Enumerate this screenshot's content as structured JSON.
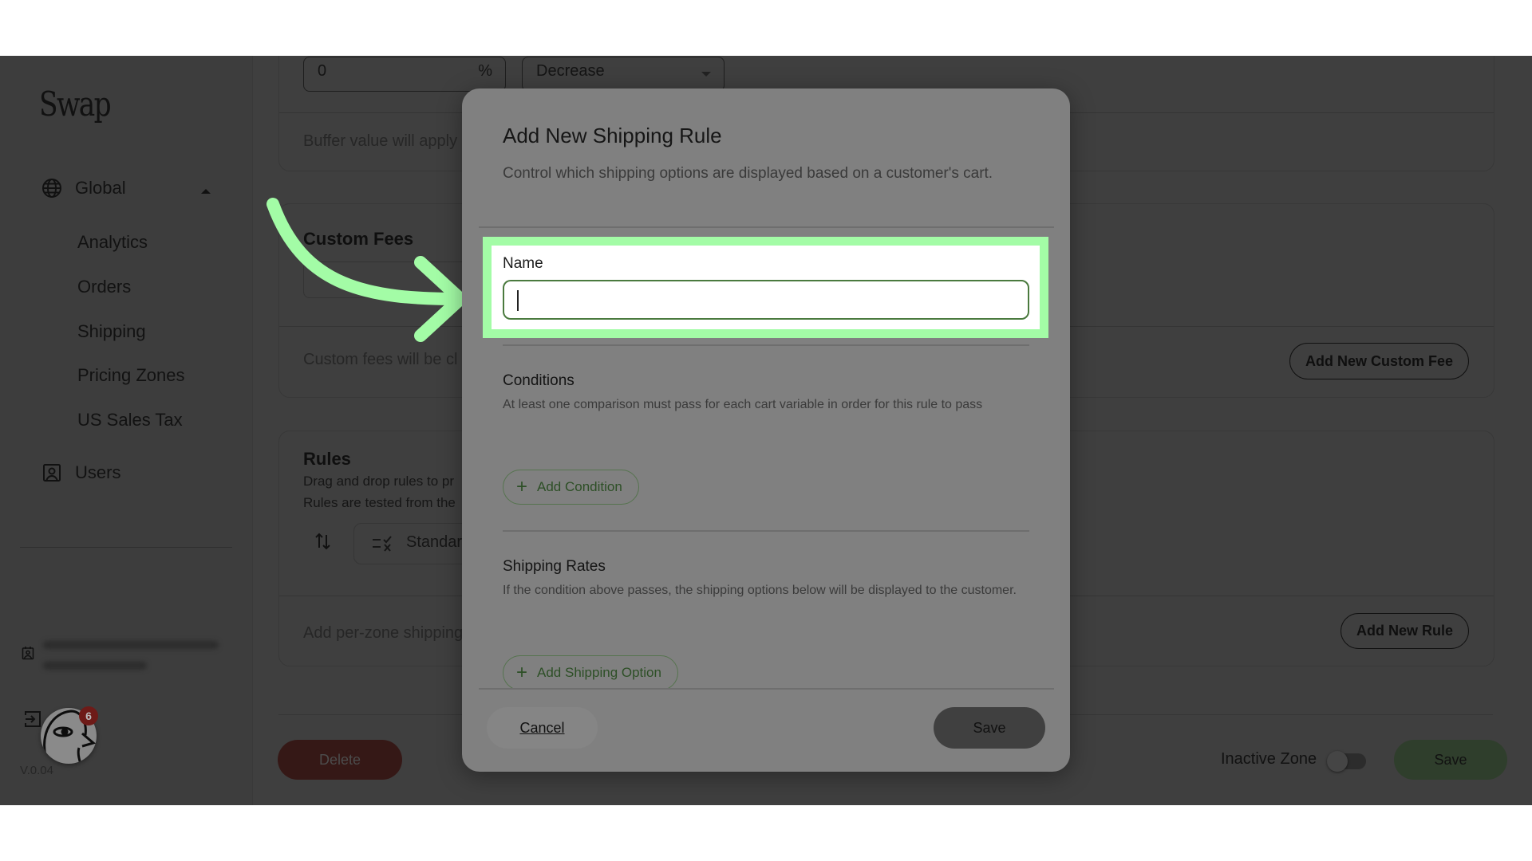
{
  "sidebar": {
    "logo": "Swap",
    "global_label": "Global",
    "sub_items": [
      "Analytics",
      "Orders",
      "Shipping",
      "Pricing Zones",
      "US Sales Tax"
    ],
    "users_label": "Users",
    "version": "V.0.04",
    "notification_count": "6"
  },
  "main": {
    "buffer_value": "0",
    "buffer_unit": "%",
    "buffer_direction": "Decrease",
    "buffer_note": "Buffer value will apply",
    "custom_fees": {
      "title": "Custom Fees",
      "note": "Custom fees will be cl",
      "add_button": "Add New Custom Fee"
    },
    "rules": {
      "title": "Rules",
      "desc_line1": "Drag and drop rules to pr",
      "desc_line2": "Rules are tested from the",
      "rule_item": "Standar",
      "note": "Add per-zone shipping",
      "add_button": "Add New Rule"
    },
    "footer": {
      "delete_label": "Delete",
      "inactive_label": "Inactive Zone",
      "inactive_on": false,
      "save_label": "Save"
    }
  },
  "modal": {
    "title": "Add New Shipping Rule",
    "description": "Control which shipping options are displayed based on a customer's cart.",
    "name_label": "Name",
    "name_value": "",
    "conditions_title": "Conditions",
    "conditions_desc": "At least one comparison must pass for each cart variable in order for this rule to pass",
    "add_condition": "Add Condition",
    "rates_title": "Shipping Rates",
    "rates_desc": "If the condition above passes, the shipping options below will be displayed to the customer.",
    "add_shipping_option": "Add Shipping Option",
    "cancel": "Cancel",
    "save": "Save"
  },
  "annotation": {
    "highlight_color": "#a3fca6"
  }
}
